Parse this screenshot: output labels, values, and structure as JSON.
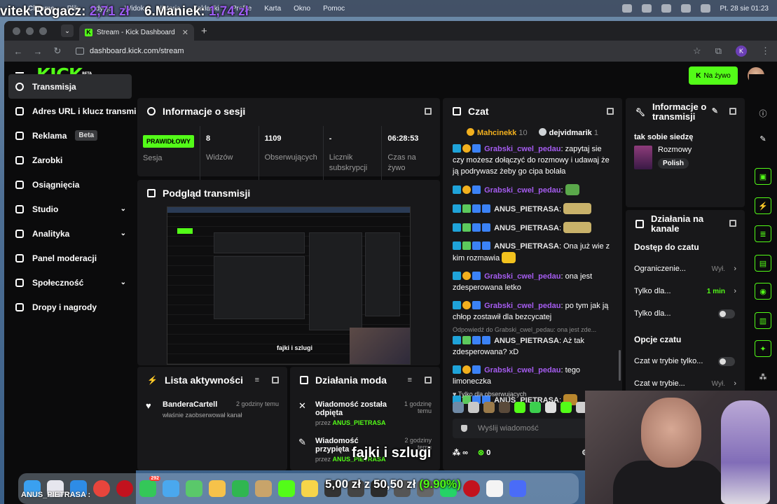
{
  "menubar": {
    "items": [
      "Chrome",
      "Plik",
      "Edycja",
      "Widok",
      "Historia",
      "Zakładki",
      "Profile",
      "Karta",
      "Okno",
      "Pomoc"
    ],
    "clock": "Pt. 28 sie  01:23"
  },
  "top_overlay": {
    "left_name": "vitek Rogacz:",
    "left_amount": "2,71 zł",
    "right_name": "6.Maniek:",
    "right_amount": "1,74 zł"
  },
  "browser": {
    "tab_title": "Stream - Kick Dashboard",
    "url": "dashboard.kick.com/stream",
    "profile_initial": "K"
  },
  "header": {
    "logo": "KICK",
    "logo_badge": "BETA",
    "live_button": "Na żywo"
  },
  "sidebar": {
    "items": [
      {
        "label": "Transmisja"
      },
      {
        "label": "Adres URL i klucz transmisji"
      },
      {
        "label": "Reklama",
        "badge": "Beta"
      },
      {
        "label": "Zarobki"
      },
      {
        "label": "Osiągnięcia"
      },
      {
        "label": "Studio"
      },
      {
        "label": "Analityka"
      },
      {
        "label": "Panel moderacji"
      },
      {
        "label": "Społeczność"
      },
      {
        "label": "Dropy i nagrody"
      }
    ]
  },
  "session": {
    "title": "Informacje o sesji",
    "status": "PRAWIDŁOWY",
    "stats": [
      {
        "value": "",
        "label": "Sesja"
      },
      {
        "value": "8",
        "label": "Widzów"
      },
      {
        "value": "1109",
        "label": "Obserwujących"
      },
      {
        "value": "-",
        "label": "Licznik subskrypcji"
      },
      {
        "value": "06:28:53",
        "label": "Czas na żywo"
      }
    ]
  },
  "preview": {
    "title": "Podgląd transmisji",
    "caption": "fajki i szlugi"
  },
  "activity": {
    "title": "Lista aktywności",
    "items": [
      {
        "name": "BanderaCartell",
        "sub": "właśnie zaobserwował kanał",
        "time": "2 godziny temu"
      }
    ]
  },
  "mod_actions": {
    "title": "Działania moda",
    "items": [
      {
        "action": "Wiadomość została odpięta",
        "by": "przez",
        "user": "ANUS_PIETRASA",
        "time": "1 godzinę temu"
      },
      {
        "action": "Wiadomość przypięta",
        "by": "przez",
        "user": "ANUS_PIETRASA",
        "time": "2 godziny temu"
      }
    ]
  },
  "chat": {
    "title": "Czat",
    "top": [
      {
        "name": "Mahcinekk",
        "count": "10"
      },
      {
        "name": "dejvidmarik",
        "count": "1"
      }
    ],
    "messages": [
      {
        "user": "Grabski_cwel_pedau",
        "color": "purple",
        "text": "zapytaj sie czy możesz dołączyć do rozmowy i udawaj że ją podrywasz żeby go cipa bolała",
        "reply": ""
      },
      {
        "user": "Grabski_cwel_pedau",
        "color": "purple",
        "text": "",
        "reply": ""
      },
      {
        "user": "ANUS_PIETRASA",
        "color": "white",
        "text": "",
        "reply": ""
      },
      {
        "user": "ANUS_PIETRASA",
        "color": "white",
        "text": "",
        "reply": ""
      },
      {
        "user": "ANUS_PIETRASA",
        "color": "white",
        "text": "Ona już wie z kim rozmawia",
        "reply": ""
      },
      {
        "user": "Grabski_cwel_pedau",
        "color": "purple",
        "text": "ona jest zdesperowana letko",
        "reply": ""
      },
      {
        "user": "Grabski_cwel_pedau",
        "color": "purple",
        "text": "po tym jak ją chłop zostawił dla bezcycatej",
        "reply": ""
      },
      {
        "user": "ANUS_PIETRASA",
        "color": "white",
        "text": "Aż tak zdesperowana? xD",
        "reply": "Odpowiedź do Grabski_cwel_pedau: ona jest zde..."
      },
      {
        "user": "Grabski_cwel_pedau",
        "color": "purple",
        "text": "tego limoneczka",
        "reply": ""
      },
      {
        "user": "ANUS_PIETRASA",
        "color": "white",
        "text": "",
        "reply": ""
      }
    ],
    "follower_only": "Tylko dla obserwujących",
    "input_placeholder": "Wyślij wiadomość",
    "infinity": "∞",
    "points": "0"
  },
  "stream_info": {
    "title": "Informacje o transmisji",
    "stream_title": "tak sobie siedzę",
    "category": "Rozmowy",
    "tag": "Polish"
  },
  "channel_actions": {
    "title": "Działania na kanale",
    "access_title": "Dostęp do czatu",
    "rows": [
      {
        "label": "Ograniczenie...",
        "value": "Wył."
      },
      {
        "label": "Tylko dla...",
        "value": "1 min"
      },
      {
        "label": "Tylko dla...",
        "value": ""
      }
    ],
    "options_title": "Opcje czatu",
    "option_rows": [
      {
        "label": "Czat w trybie tylko...",
        "value": ""
      },
      {
        "label": "Czat w trybie...",
        "value": "Wył."
      }
    ]
  },
  "bottom_overlay": {
    "amount": "5,00 zł",
    "separator": "z",
    "goal": "50,50 zł",
    "percent": "(9.90%)",
    "caption": "fajki i szlugi",
    "left_tag": "ANUS_PIETRASA :"
  },
  "dock": {
    "badge": "292"
  }
}
